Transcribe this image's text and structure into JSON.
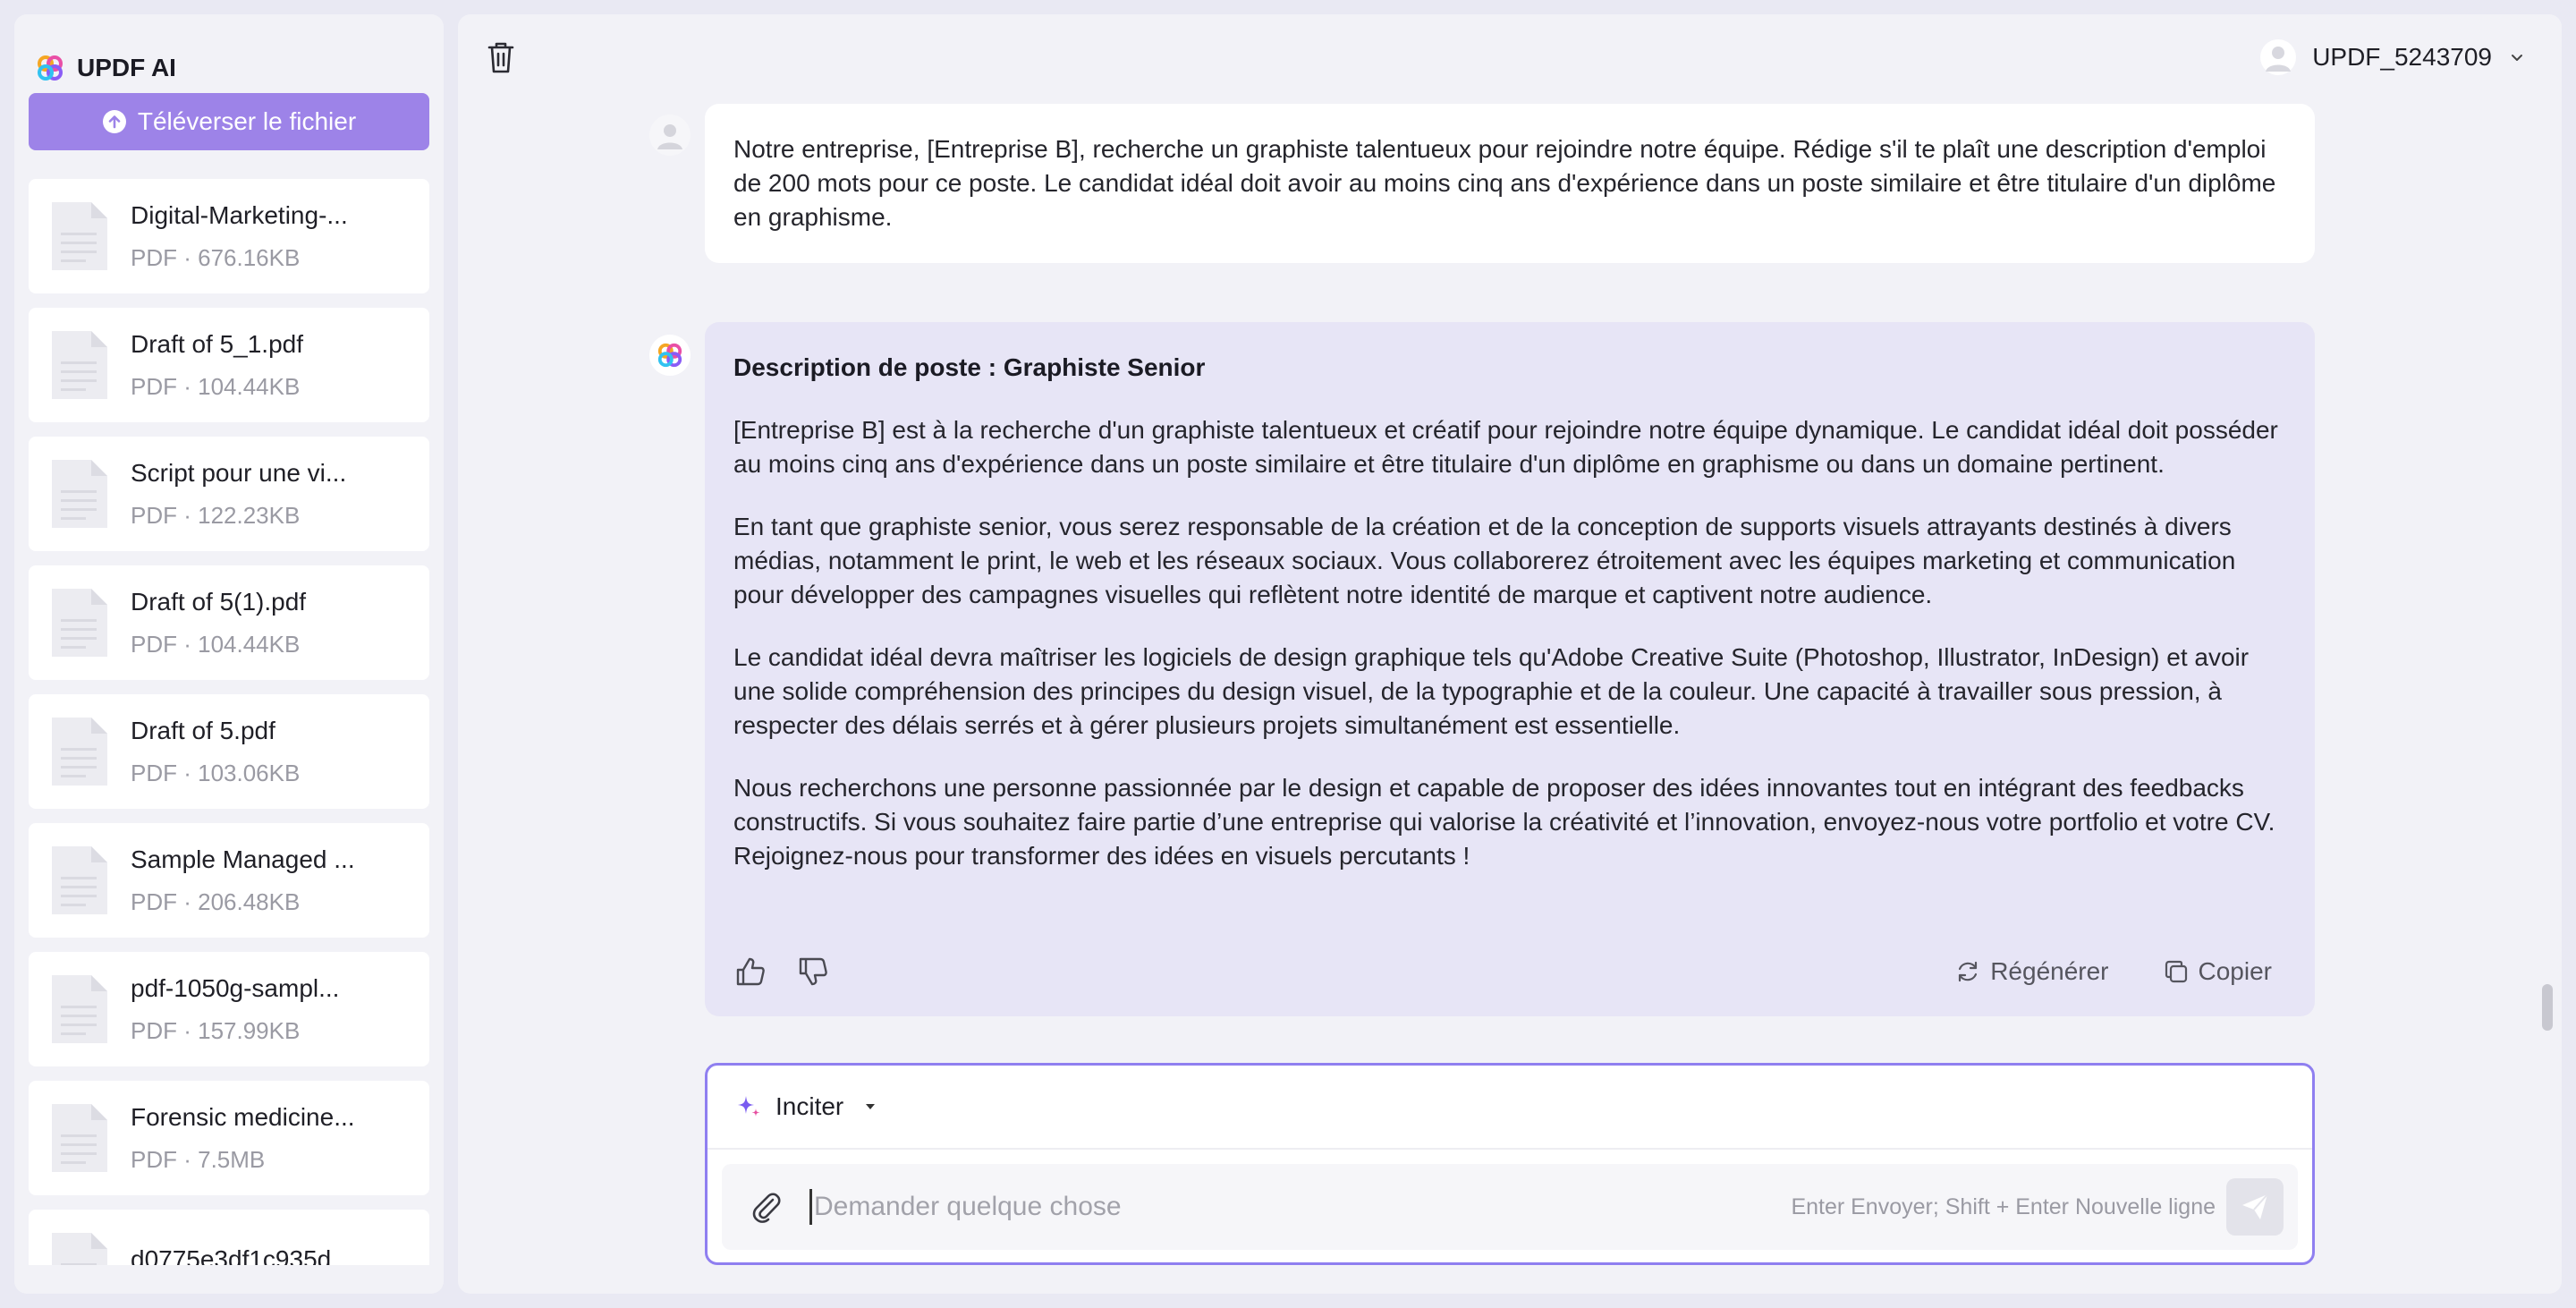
{
  "sidebar": {
    "brand": "UPDF AI",
    "upload_label": "Téléverser le fichier",
    "files": [
      {
        "name": "Digital-Marketing-...",
        "info": "PDF · 676.16KB"
      },
      {
        "name": "Draft of 5_1.pdf",
        "info": "PDF · 104.44KB"
      },
      {
        "name": "Script pour une vi...",
        "info": "PDF · 122.23KB"
      },
      {
        "name": "Draft of 5(1).pdf",
        "info": "PDF · 104.44KB"
      },
      {
        "name": "Draft of 5.pdf",
        "info": "PDF · 103.06KB"
      },
      {
        "name": "Sample Managed ...",
        "info": "PDF · 206.48KB"
      },
      {
        "name": "pdf-1050g-sampl...",
        "info": "PDF · 157.99KB"
      },
      {
        "name": "Forensic medicine...",
        "info": "PDF · 7.5MB"
      },
      {
        "name": "d0775e3df1c935d...",
        "info": ""
      }
    ]
  },
  "header": {
    "username": "UPDF_5243709"
  },
  "chat": {
    "user_message": "Notre entreprise, [Entreprise B], recherche un graphiste talentueux pour rejoindre notre équipe. Rédige s'il te plaît une description d'emploi de 200 mots pour ce poste. Le candidat idéal doit avoir au moins cinq ans d'expérience dans un poste similaire et être titulaire d'un diplôme en graphisme.",
    "ai_heading": "Description de poste : Graphiste Senior",
    "ai_paragraphs": [
      "[Entreprise B] est à la recherche d'un graphiste talentueux et créatif pour rejoindre notre équipe dynamique. Le candidat idéal doit posséder au moins cinq ans d'expérience dans un poste similaire et être titulaire d'un diplôme en graphisme ou dans un domaine pertinent.",
      "En tant que graphiste senior, vous serez responsable de la création et de la conception de supports visuels attrayants destinés à divers médias, notamment le print, le web et les réseaux sociaux. Vous collaborerez étroitement avec les équipes marketing et communication pour développer des campagnes visuelles qui reflètent notre identité de marque et captivent notre audience.",
      "Le candidat idéal devra maîtriser les logiciels de design graphique tels qu'Adobe Creative Suite (Photoshop, Illustrator, InDesign) et avoir une solide compréhension des principes du design visuel, de la typographie et de la couleur. Une capacité à travailler sous pression, à respecter des délais serrés et à gérer plusieurs projets simultanément est essentielle.",
      "Nous recherchons une personne passionnée par le design et capable de proposer des idées innovantes tout en intégrant des feedbacks constructifs. Si vous souhaitez faire partie d’une entreprise qui valorise la créativité et l’innovation, envoyez-nous votre portfolio et votre CV. Rejoignez-nous pour transformer des idées en visuels percutants !"
    ],
    "regenerate_label": "Régénérer",
    "copy_label": "Copier"
  },
  "composer": {
    "prompt_label": "Inciter",
    "placeholder": "Demander quelque chose",
    "hint": "Enter Envoyer; Shift + Enter Nouvelle ligne"
  },
  "colors": {
    "accent": "#9d83e8",
    "composer_border": "#8f7ff0",
    "ai_bubble": "#e7e5f6"
  }
}
